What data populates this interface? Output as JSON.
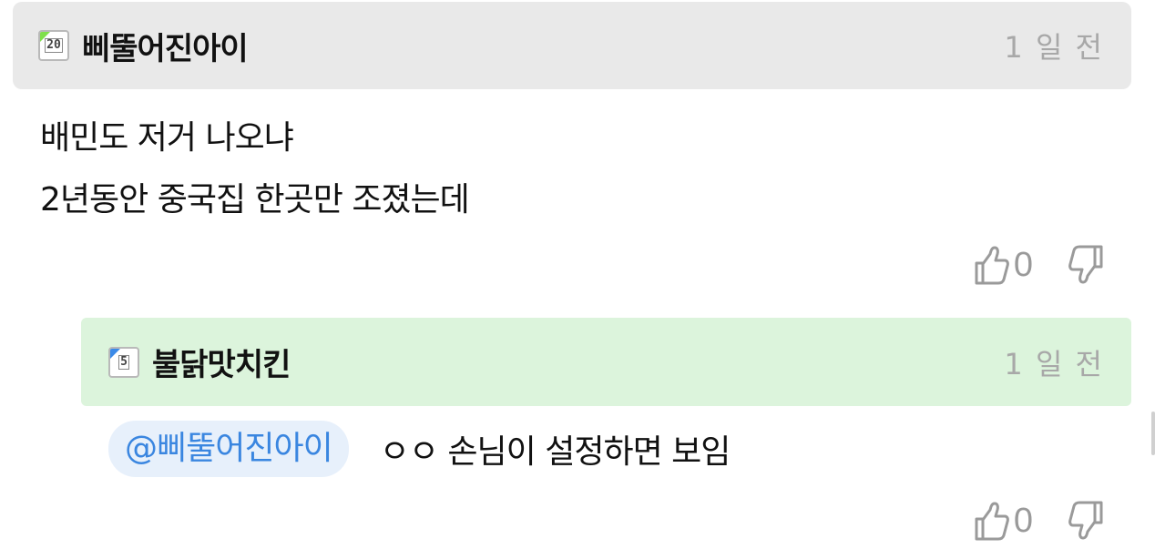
{
  "comment": {
    "author": "삐뚤어진아이",
    "level": "20",
    "time": "1 일 전",
    "lines": [
      "배민도 저거 나오냐",
      "2년동안 중국집 한곳만 조졌는데"
    ],
    "likes": "0",
    "badge_color": "#7fe04a",
    "header_bg": "#e9e9e9"
  },
  "reply": {
    "author": "불닭맛치킨",
    "level": "5",
    "time": "1 일 전",
    "mention": "@삐뚤어진아이",
    "text": "ㅇㅇ 손님이 설정하면 보임",
    "likes": "0",
    "badge_color": "#3a8ae8",
    "header_bg": "#dcf4dc"
  },
  "icons": {
    "like": "thumbs-up-icon",
    "dislike": "thumbs-down-icon"
  }
}
